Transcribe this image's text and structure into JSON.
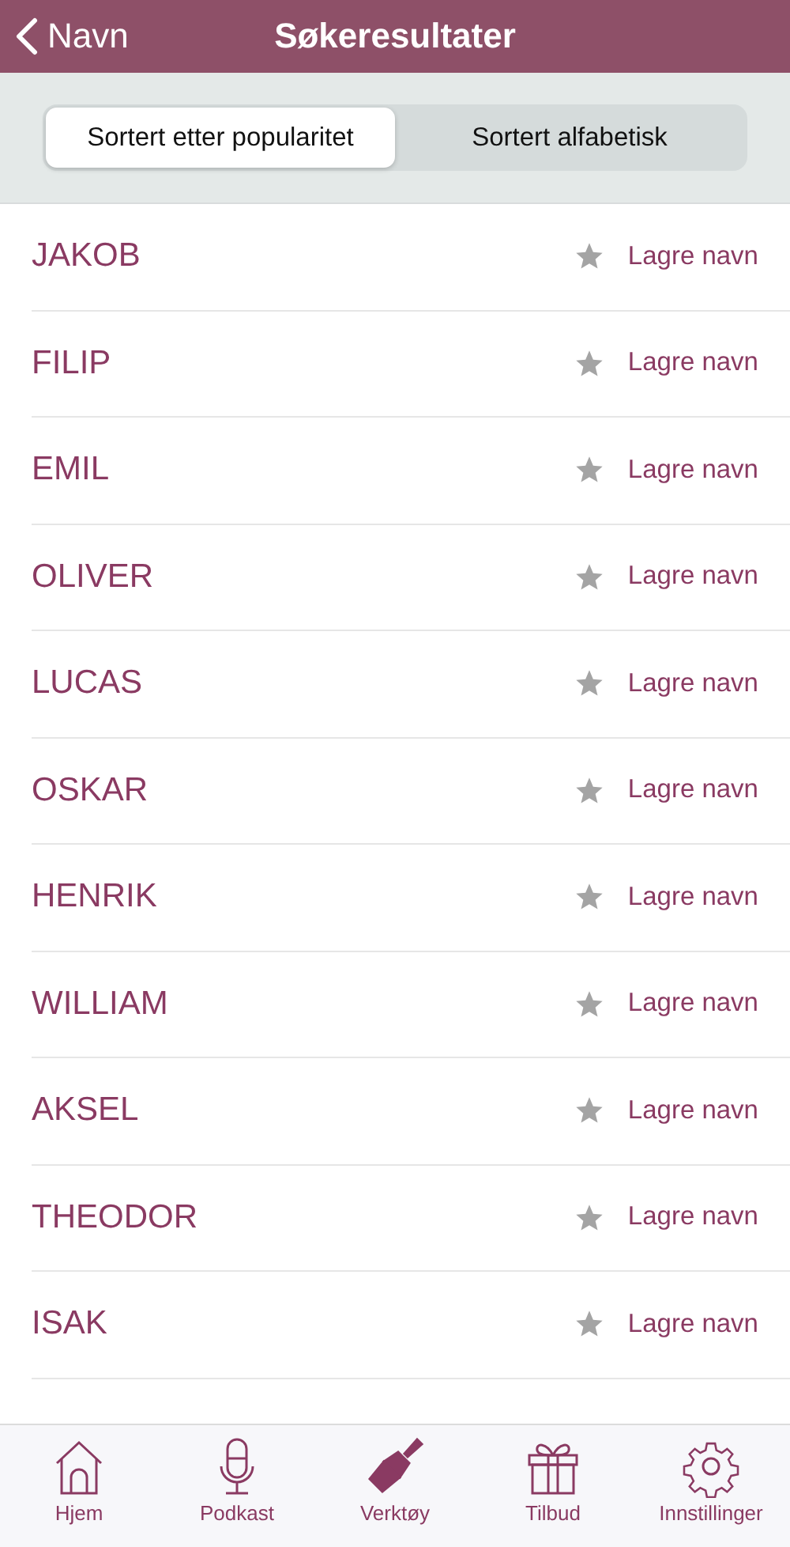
{
  "header": {
    "back_label": "Navn",
    "title": "Søkeresultater"
  },
  "sort_options": [
    {
      "label": "Sortert etter popularitet",
      "selected": true
    },
    {
      "label": "Sortert alfabetisk",
      "selected": false
    }
  ],
  "names": [
    {
      "name": "JAKOB",
      "action": "Lagre navn",
      "saved": false
    },
    {
      "name": "FILIP",
      "action": "Lagre navn",
      "saved": false
    },
    {
      "name": "EMIL",
      "action": "Lagre navn",
      "saved": false
    },
    {
      "name": "OLIVER",
      "action": "Lagre navn",
      "saved": false
    },
    {
      "name": "LUCAS",
      "action": "Lagre navn",
      "saved": false
    },
    {
      "name": "OSKAR",
      "action": "Lagre navn",
      "saved": false
    },
    {
      "name": "HENRIK",
      "action": "Lagre navn",
      "saved": false
    },
    {
      "name": "WILLIAM",
      "action": "Lagre navn",
      "saved": false
    },
    {
      "name": "AKSEL",
      "action": "Lagre navn",
      "saved": false
    },
    {
      "name": "THEODOR",
      "action": "Lagre navn",
      "saved": false
    },
    {
      "name": "ISAK",
      "action": "Lagre navn",
      "saved": false
    }
  ],
  "tab_bar": [
    {
      "label": "Hjem",
      "kind": "home",
      "selected": false
    },
    {
      "label": "Podkast",
      "kind": "microphone",
      "selected": false
    },
    {
      "label": "Verktøy",
      "kind": "brush",
      "selected": true
    },
    {
      "label": "Tilbud",
      "kind": "gift",
      "selected": false
    },
    {
      "label": "Innstillinger",
      "kind": "gear",
      "selected": false
    }
  ]
}
